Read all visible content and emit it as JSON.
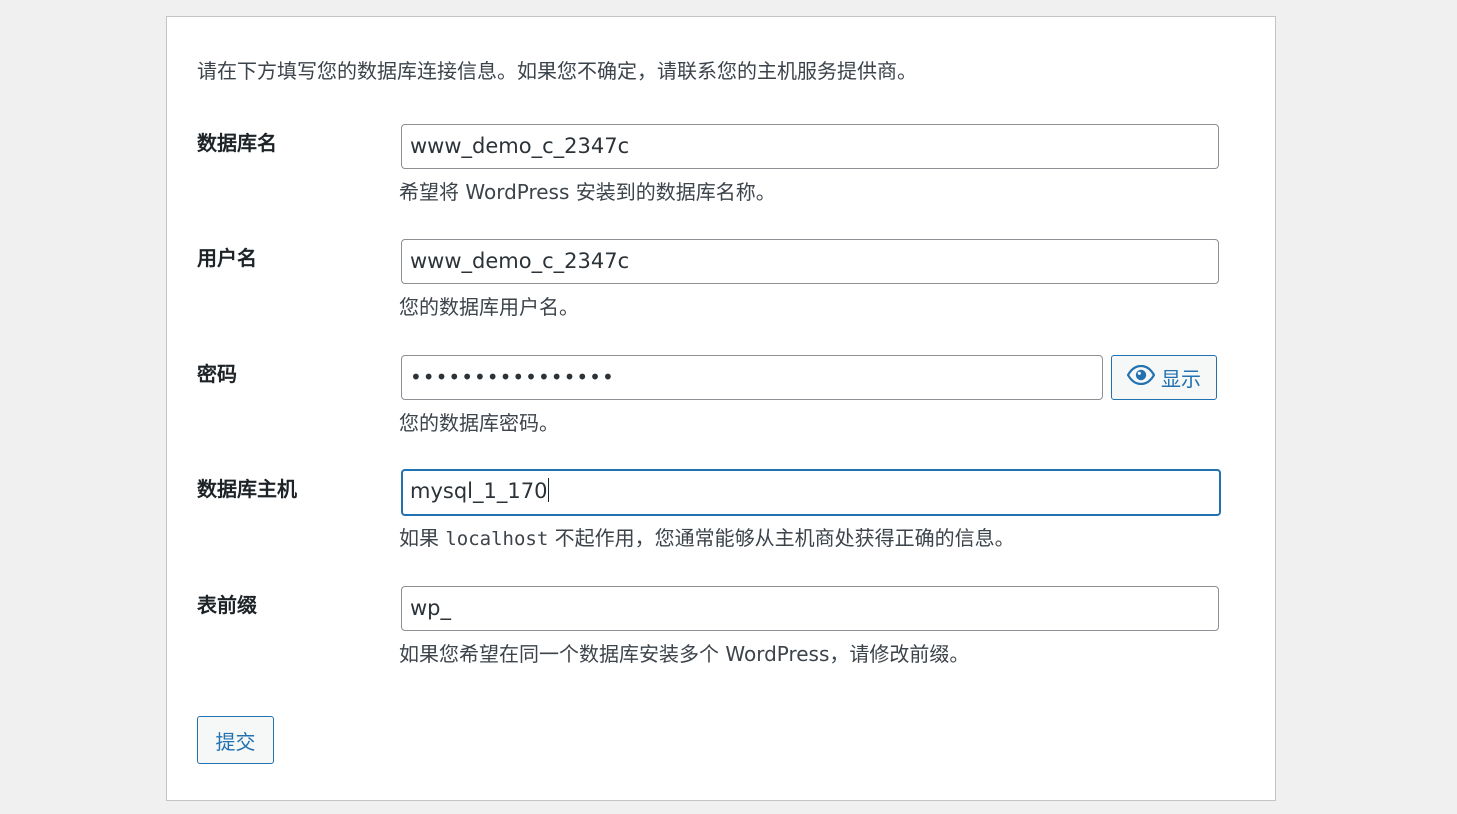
{
  "intro_text": "请在下方填写您的数据库连接信息。如果您不确定，请联系您的主机服务提供商。",
  "fields": {
    "dbname": {
      "label": "数据库名",
      "value": "www_demo_c_2347c",
      "description": "希望将 WordPress 安装到的数据库名称。"
    },
    "username": {
      "label": "用户名",
      "value": "www_demo_c_2347c",
      "description": "您的数据库用户名。"
    },
    "password": {
      "label": "密码",
      "masked_value": "••••••••••••••••",
      "show_button_label": "显示",
      "show_button_icon": "eye-icon",
      "description": "您的数据库密码。"
    },
    "dbhost": {
      "label": "数据库主机",
      "value": "mysql_1_170",
      "focused": true,
      "description_before": "如果 ",
      "description_code": "localhost",
      "description_after": " 不起作用，您通常能够从主机商处获得正确的信息。"
    },
    "prefix": {
      "label": "表前缀",
      "value": "wp_",
      "description": "如果您希望在同一个数据库安装多个 WordPress，请修改前缀。"
    }
  },
  "submit_label": "提交",
  "colors": {
    "background": "#f0f0f1",
    "accent": "#2271b1",
    "border": "#8c8f94",
    "text": "#3c434a"
  }
}
